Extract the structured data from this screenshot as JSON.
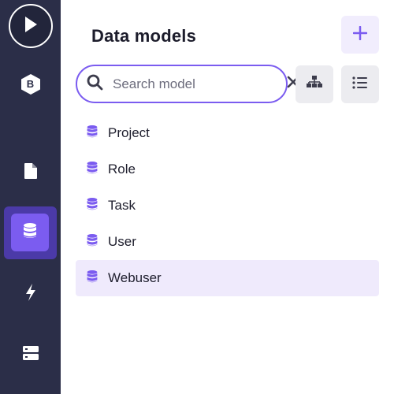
{
  "colors": {
    "sidebar_bg": "#2b2e48",
    "accent": "#7b5cf0",
    "selected_row_bg": "#efeafc",
    "tool_button_bg": "#ececf0"
  },
  "sidebar": {
    "items": [
      {
        "icon": "play-icon"
      },
      {
        "icon": "bootstrap-b-icon",
        "label": "B"
      },
      {
        "icon": "document-icon"
      },
      {
        "icon": "database-icon",
        "active": true
      },
      {
        "icon": "lightning-icon"
      },
      {
        "icon": "server-icon"
      }
    ]
  },
  "header": {
    "title": "Data models",
    "add_icon": "plus-icon"
  },
  "search": {
    "placeholder": "Search model",
    "value": ""
  },
  "toolbar": {
    "diagram_icon": "hierarchy-icon",
    "list_icon": "list-icon"
  },
  "models": [
    {
      "label": "Project",
      "selected": false
    },
    {
      "label": "Role",
      "selected": false
    },
    {
      "label": "Task",
      "selected": false
    },
    {
      "label": "User",
      "selected": false
    },
    {
      "label": "Webuser",
      "selected": true
    }
  ]
}
